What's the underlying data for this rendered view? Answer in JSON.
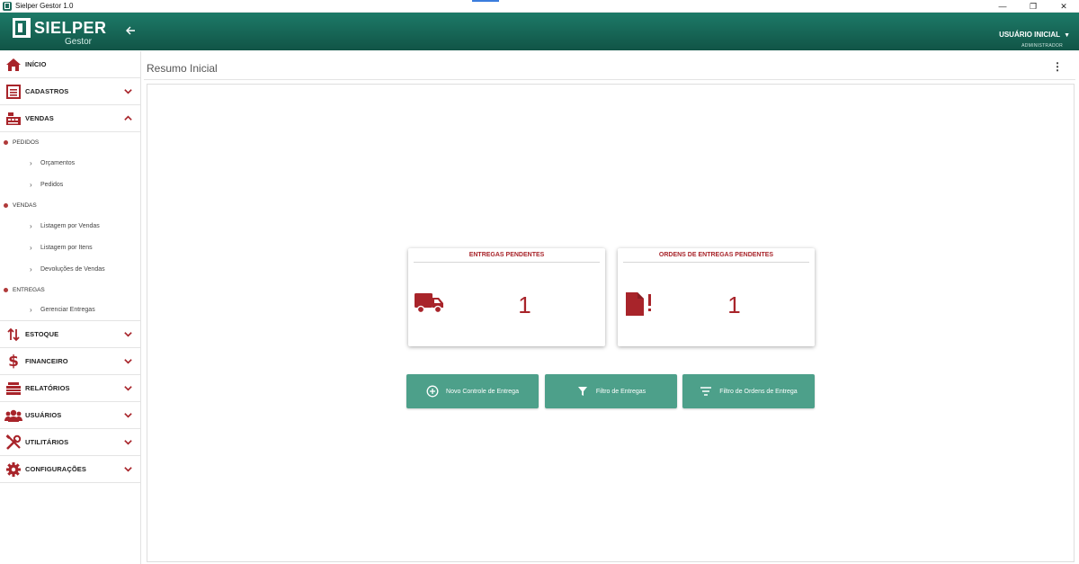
{
  "window": {
    "title": "Sielper Gestor 1.0",
    "minimize": "—",
    "restore": "❐",
    "close": "✕"
  },
  "header": {
    "brand": "SIELPER",
    "brand_sub": "Gestor",
    "user_name": "USUÁRIO INICIAL",
    "user_role": "ADMINISTRADOR"
  },
  "colors": {
    "header": "#1d7a68",
    "accent_red": "#a8242a",
    "button": "#4da08a"
  },
  "sidebar": {
    "inicio": "INÍCIO",
    "cadastros": "CADASTROS",
    "vendas": "VENDAS",
    "sections": {
      "pedidos": "PEDIDOS",
      "vendas": "VENDAS",
      "entregas": "ENTREGAS"
    },
    "sub": {
      "orcamentos": "Orçamentos",
      "pedidos": "Pedidos",
      "listagem_vendas": "Listagem por Vendas",
      "listagem_itens": "Listagem por Itens",
      "devolucoes": "Devoluções de Vendas",
      "gerenciar_entregas": "Gerenciar Entregas"
    },
    "estoque": "ESTOQUE",
    "financeiro": "FINANCEIRO",
    "relatorios": "RELATÓRIOS",
    "usuarios": "USUÁRIOS",
    "utilitarios": "UTILITÁRIOS",
    "configuracoes": "CONFIGURAÇÕES"
  },
  "main": {
    "title": "Resumo Inicial",
    "cards": {
      "entregas": {
        "title": "ENTREGAS PENDENTES",
        "value": "1"
      },
      "ordens": {
        "title": "ORDENS DE ENTREGAS PENDENTES",
        "value": "1"
      }
    },
    "buttons": {
      "novo": "Novo Controle de Entrega",
      "filtro_entregas": "Filtro de Entregas",
      "filtro_ordens": "Filtro de Ordens de Entrega"
    }
  }
}
